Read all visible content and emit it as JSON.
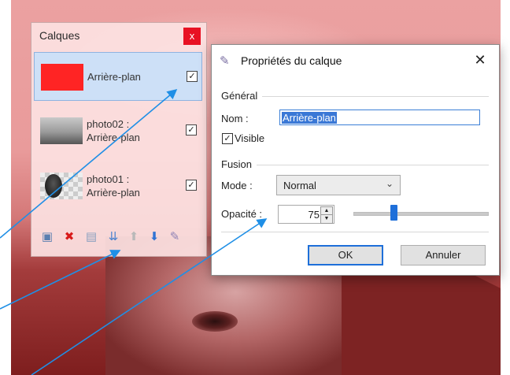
{
  "colors": {
    "accent": "#1e6fd9",
    "close_red": "#e81123",
    "layer_red": "#ff2424",
    "arrow": "#1f8fe6"
  },
  "layers_panel": {
    "title": "Calques",
    "close_glyph": "x",
    "layers": [
      {
        "name": "Arrière-plan",
        "visible": true,
        "selected": true
      },
      {
        "name": "photo02 : Arrière-plan",
        "line1": "photo02 :",
        "line2": "Arrière-plan",
        "visible": true,
        "selected": false
      },
      {
        "name": "photo01 : Arrière-plan",
        "line1": "photo01 :",
        "line2": "Arrière-plan",
        "visible": true,
        "selected": false
      }
    ],
    "toolbar_icons": [
      "add-layer-icon",
      "delete-layer-icon",
      "duplicate-layer-icon",
      "merge-down-icon",
      "move-up-icon",
      "move-down-icon",
      "layer-properties-icon"
    ]
  },
  "dialog": {
    "title": "Propriétés du calque",
    "close_glyph": "✕",
    "general_label": "Général",
    "name_label": "Nom :",
    "name_value": "Arrière-plan",
    "visible_label": "Visible",
    "visible_checked": true,
    "fusion_label": "Fusion",
    "mode_label": "Mode :",
    "mode_value": "Normal",
    "opacity_label": "Opacité :",
    "opacity_value": "75",
    "ok_label": "OK",
    "cancel_label": "Annuler"
  }
}
